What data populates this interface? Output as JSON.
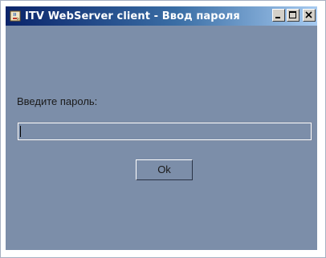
{
  "window": {
    "title": "ITV WebServer client - Ввод пароля"
  },
  "prompt": {
    "label": "Введите пароль:"
  },
  "password": {
    "value": ""
  },
  "actions": {
    "ok_label": "Ok"
  },
  "colors": {
    "background": "#7c8ea9",
    "titlebar_start": "#0a246a",
    "titlebar_end": "#a6caf0"
  },
  "icons": {
    "app": "java-cup-icon",
    "minimize": "minimize-icon",
    "maximize": "maximize-icon",
    "close": "close-icon"
  }
}
